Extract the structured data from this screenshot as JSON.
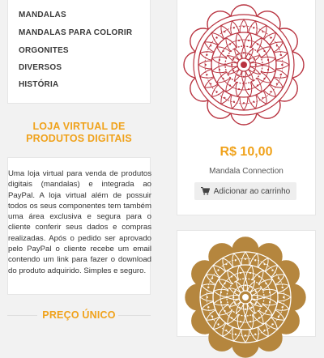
{
  "sidebar": {
    "menu": [
      {
        "label": "MANDALAS"
      },
      {
        "label": "MANDALAS PARA COLORIR"
      },
      {
        "label": "ORGONITES"
      },
      {
        "label": "DIVERSOS"
      },
      {
        "label": "HISTÓRIA"
      }
    ],
    "store_title": "LOJA VIRTUAL DE PRODUTOS DIGITAIS",
    "store_description": "Uma loja virtual para venda de produtos digitais (mandalas) e integrada ao PayPal. A loja virtual além de possuir todos os seus componentes tem também uma área exclusiva e segura para o cliente conferir seus dados e compras realizadas. Após o pedido ser aprovado pelo PayPal o cliente recebe um email contendo um link para fazer o download do produto adquirido. Simples e seguro.",
    "price_title": "PREÇO ÚNICO"
  },
  "products": [
    {
      "price": "R$ 10,00",
      "name": "Mandala Connection",
      "button_label": "Adicionar ao carrinho",
      "button_icon": "shopping-cart-icon",
      "image_color": "#b8323f"
    },
    {
      "image_color": "#b5863e"
    }
  ],
  "colors": {
    "accent": "#f0a21b",
    "background": "#f2f2f2",
    "card": "#ffffff"
  }
}
